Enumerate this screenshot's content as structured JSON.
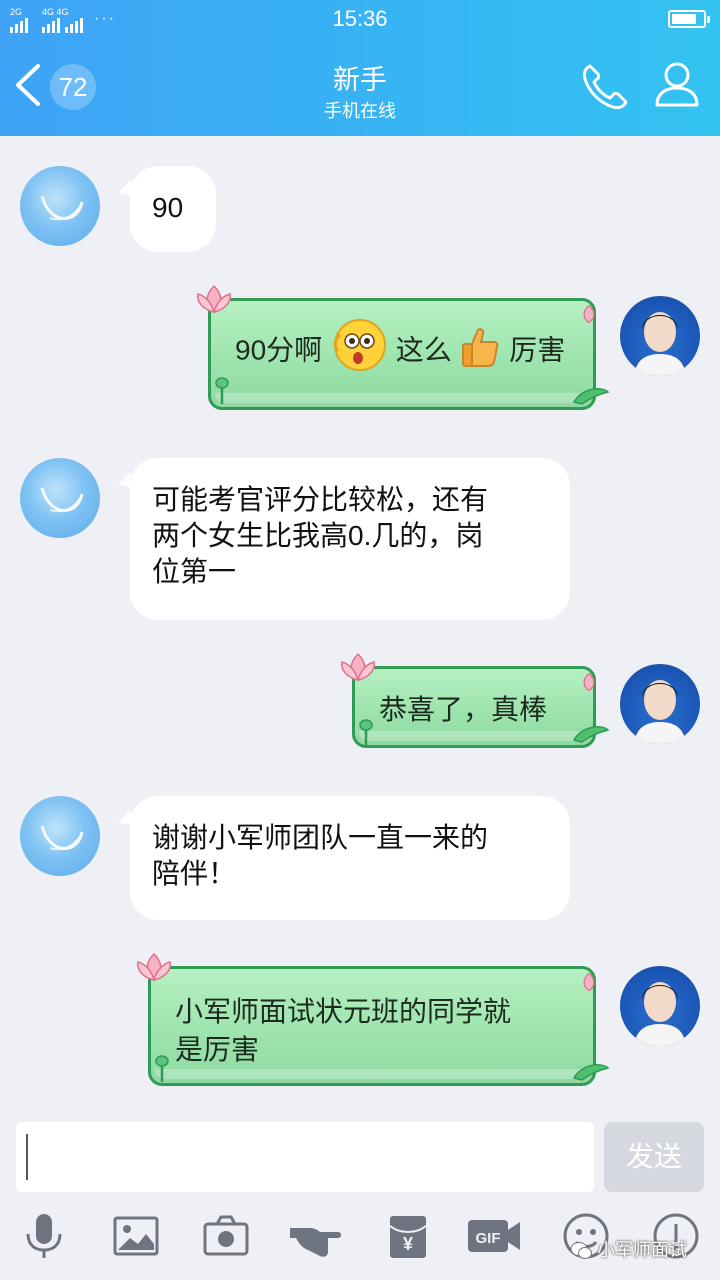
{
  "status_bar": {
    "network_1": "2G",
    "network_2": "4G 4G",
    "more": "···",
    "time": "15:36"
  },
  "header": {
    "unread_count": "72",
    "contact_name": "新手",
    "contact_status": "手机在线"
  },
  "messages": [
    {
      "from": "contact",
      "text_lines": [
        "90"
      ]
    },
    {
      "from": "me",
      "parts": [
        "90分啊",
        "这么",
        "厉害"
      ],
      "emojis": [
        "surprised-emoji",
        "thumbs-up-emoji"
      ]
    },
    {
      "from": "contact",
      "text_lines": [
        "可能考官评分比较松，还有",
        "两个女生比我高0.几的，岗",
        "位第一"
      ]
    },
    {
      "from": "me",
      "text_lines": [
        "恭喜了，真棒"
      ]
    },
    {
      "from": "contact",
      "text_lines": [
        "谢谢小军师团队一直一来的",
        "陪伴！"
      ]
    },
    {
      "from": "me",
      "text_lines": [
        "小军师面试状元班的同学就",
        "是厉害"
      ]
    }
  ],
  "composer": {
    "input_value": "",
    "send_label": "发送"
  },
  "toolbar": {
    "items": [
      "microphone-icon",
      "image-icon",
      "camera-icon",
      "poke-icon",
      "red-packet-icon",
      "gif-icon",
      "emoji-icon",
      "more-icon"
    ],
    "gif_label": "GIF",
    "yen_label": "¥"
  },
  "watermark": "小军师面试",
  "colors": {
    "header_start": "#3fa3f6",
    "header_end": "#33c3f1",
    "outgoing_bubble": "#9ee4ae",
    "outgoing_border": "#2f9b55",
    "page_bg": "#eef0f6"
  }
}
